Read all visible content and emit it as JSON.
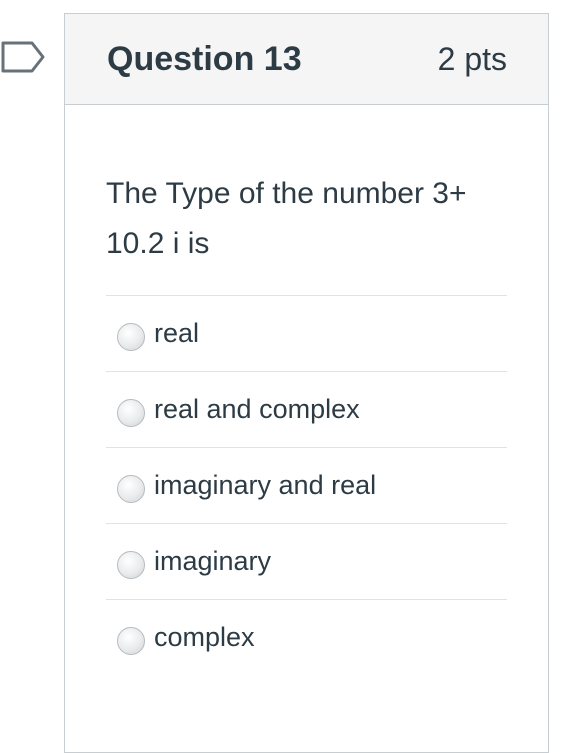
{
  "question": {
    "title": "Question 13",
    "points": "2 pts",
    "text": "The Type of the number 3+ 10.2 i  is",
    "flag_icon": "flag-icon"
  },
  "answers": [
    {
      "label": "real",
      "selected": false
    },
    {
      "label": "real and complex",
      "selected": false
    },
    {
      "label": "imaginary and real",
      "selected": false
    },
    {
      "label": "imaginary",
      "selected": false
    },
    {
      "label": "complex",
      "selected": false
    }
  ],
  "colors": {
    "text": "#2d3b45",
    "header_bg": "#f5f5f5",
    "border": "#c7cdd1",
    "divider": "#dfe3e5",
    "flag_stroke": "#66717a"
  }
}
